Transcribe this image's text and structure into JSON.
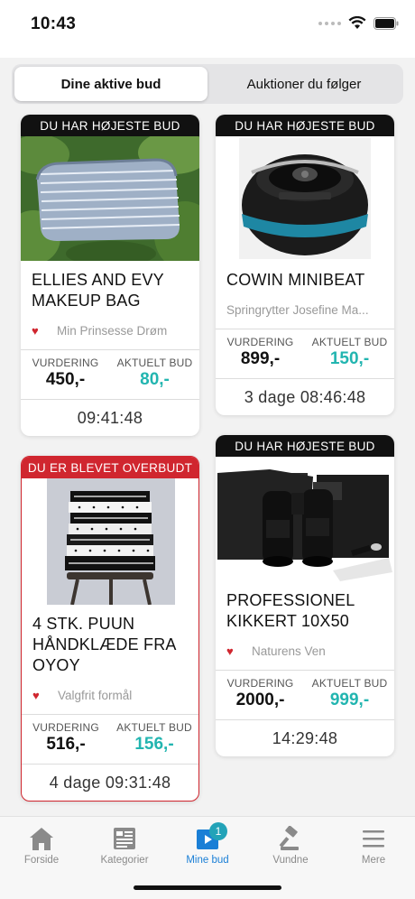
{
  "status_bar": {
    "time": "10:43"
  },
  "segments": [
    {
      "label": "Dine aktive bud",
      "active": true
    },
    {
      "label": "Auktioner du følger",
      "active": false
    }
  ],
  "labels": {
    "valuation": "VURDERING",
    "current_bid": "AKTUELT BUD"
  },
  "items": [
    {
      "badge": "DU HAR HØJESTE BUD",
      "status": "highest",
      "title": "ELLIES AND EVY MAKEUP BAG",
      "seller": "Min Prinsesse Drøm",
      "favorite": true,
      "valuation": "450,-",
      "current_bid": "80,-",
      "time_left": "09:41:48"
    },
    {
      "badge": "DU HAR HØJESTE BUD",
      "status": "highest",
      "title": "COWIN MINIBEAT",
      "seller": "Springrytter Josefine Ma...",
      "favorite": false,
      "valuation": "899,-",
      "current_bid": "150,-",
      "time_left": "3 dage 08:46:48"
    },
    {
      "badge": "DU ER BLEVET OVERBUDT",
      "status": "outbid",
      "title": "4 STK. PUUN HÅNDKLÆDE FRA OYOY",
      "seller": "Valgfrit formål",
      "favorite": true,
      "valuation": "516,-",
      "current_bid": "156,-",
      "time_left": "4 dage 09:31:48"
    },
    {
      "badge": "DU HAR HØJESTE BUD",
      "status": "highest",
      "title": "PROFESSIONEL KIKKERT 10X50",
      "seller": "Naturens Ven",
      "favorite": true,
      "valuation": "2000,-",
      "current_bid": "999,-",
      "time_left": "14:29:48"
    }
  ],
  "tabbar": [
    {
      "label": "Forside",
      "icon": "home-icon",
      "active": false
    },
    {
      "label": "Kategorier",
      "icon": "categories-icon",
      "active": false
    },
    {
      "label": "Mine bud",
      "icon": "my-bids-icon",
      "active": true,
      "badge": "1"
    },
    {
      "label": "Vundne",
      "icon": "gavel-icon",
      "active": false
    },
    {
      "label": "Mere",
      "icon": "menu-icon",
      "active": false
    }
  ],
  "colors": {
    "accent": "#1a7fd6",
    "current_bid": "#22b5b0",
    "outbid": "#d0262f",
    "badge_dark": "#111111",
    "tab_badge": "#23a3b8"
  }
}
